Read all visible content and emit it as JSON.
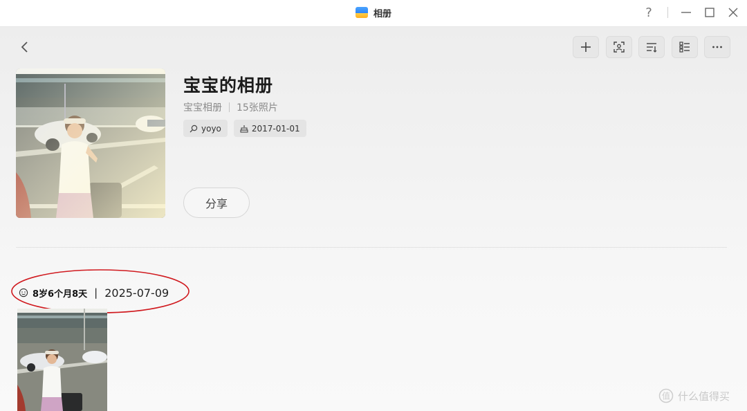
{
  "window": {
    "title": "相册",
    "help_label": "?"
  },
  "album": {
    "title": "宝宝的相册",
    "type": "宝宝相册",
    "count": "15张照片",
    "person": "yoyo",
    "date": "2017-01-01",
    "share_label": "分享"
  },
  "timeline": [
    {
      "age": "8岁6个月8天",
      "separator": "|",
      "date": "2025-07-09"
    }
  ],
  "watermark": {
    "text": "什么值得买"
  },
  "colors": {
    "annotation": "#d0191e",
    "accent": "#2f86f6"
  }
}
